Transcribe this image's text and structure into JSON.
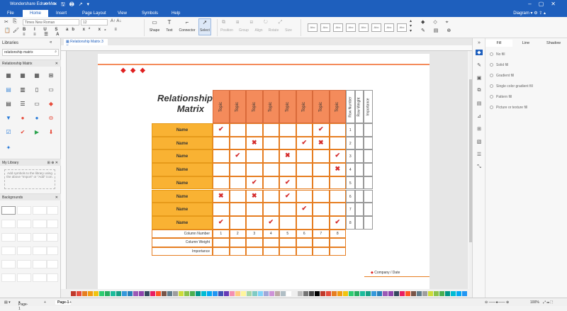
{
  "app": {
    "title": "Wondershare EdrawMax"
  },
  "menu": {
    "items": [
      "File",
      "Home",
      "Insert",
      "Page Layout",
      "View",
      "Symbols",
      "Help"
    ],
    "active": "Home",
    "diagram_label": "Diagram"
  },
  "ribbon": {
    "font_name": "Times New Roman",
    "font_size": "12",
    "tools": [
      "Shape",
      "Text",
      "Connector",
      "Select"
    ],
    "arrange": [
      "Position",
      "Group",
      "Align",
      "Rotate",
      "Size"
    ],
    "style_box": "Abc"
  },
  "libraries": {
    "title": "Libraries",
    "search_value": "relationship matrix",
    "section_rm": "Relationship Matrix",
    "section_mylib": "My Library",
    "mylib_hint": "Add symbols to the library using the above \"Import\" or \"Add\" icon.",
    "section_bg": "Backgrounds"
  },
  "doc_tab": "Relationship Matrix 3",
  "right_panel": {
    "tabs": [
      "Fill",
      "Line",
      "Shadow"
    ],
    "options": [
      "No fill",
      "Solid fill",
      "Gradient fill",
      "Single color gradient fill",
      "Pattern fill",
      "Picture or texture fill"
    ]
  },
  "matrix": {
    "title_line1": "Relationship",
    "title_line2": "Matrix",
    "topics": [
      "Topic",
      "Topic",
      "Topic",
      "Topic",
      "Topic",
      "Topic",
      "Topic",
      "Topic"
    ],
    "row_header_extra": [
      "Row Number",
      "Row Weight",
      "Importance"
    ],
    "row_label": "Name",
    "row_numbers": [
      "1",
      "2",
      "3",
      "4",
      "5",
      "6",
      "7",
      "8"
    ],
    "col_numbers": [
      "1",
      "2",
      "3",
      "4",
      "5",
      "6",
      "7",
      "8"
    ],
    "bottom_labels": [
      "Column Number",
      "Column Weight",
      "Importance"
    ],
    "footer": "Company / Date",
    "marks": [
      {
        "row": 0,
        "col": 0,
        "type": "check"
      },
      {
        "row": 0,
        "col": 6,
        "type": "check"
      },
      {
        "row": 1,
        "col": 2,
        "type": "cross"
      },
      {
        "row": 1,
        "col": 5,
        "type": "check"
      },
      {
        "row": 1,
        "col": 6,
        "type": "cross"
      },
      {
        "row": 2,
        "col": 1,
        "type": "check"
      },
      {
        "row": 2,
        "col": 4,
        "type": "cross"
      },
      {
        "row": 2,
        "col": 7,
        "type": "check"
      },
      {
        "row": 3,
        "col": 7,
        "type": "cross"
      },
      {
        "row": 4,
        "col": 2,
        "type": "check"
      },
      {
        "row": 4,
        "col": 4,
        "type": "check"
      },
      {
        "row": 5,
        "col": 0,
        "type": "cross"
      },
      {
        "row": 5,
        "col": 2,
        "type": "cross"
      },
      {
        "row": 5,
        "col": 4,
        "type": "check"
      },
      {
        "row": 6,
        "col": 5,
        "type": "check"
      },
      {
        "row": 7,
        "col": 0,
        "type": "check"
      },
      {
        "row": 7,
        "col": 3,
        "type": "check"
      },
      {
        "row": 7,
        "col": 7,
        "type": "check"
      }
    ]
  },
  "status": {
    "page_tab": "Page-1",
    "page_tab2": "Page-1",
    "zoom": "100%"
  },
  "colors": {
    "accent": "#1e5fbd",
    "topic": "#f48b5b",
    "name": "#f9b233",
    "mark": "#d42a2a"
  }
}
